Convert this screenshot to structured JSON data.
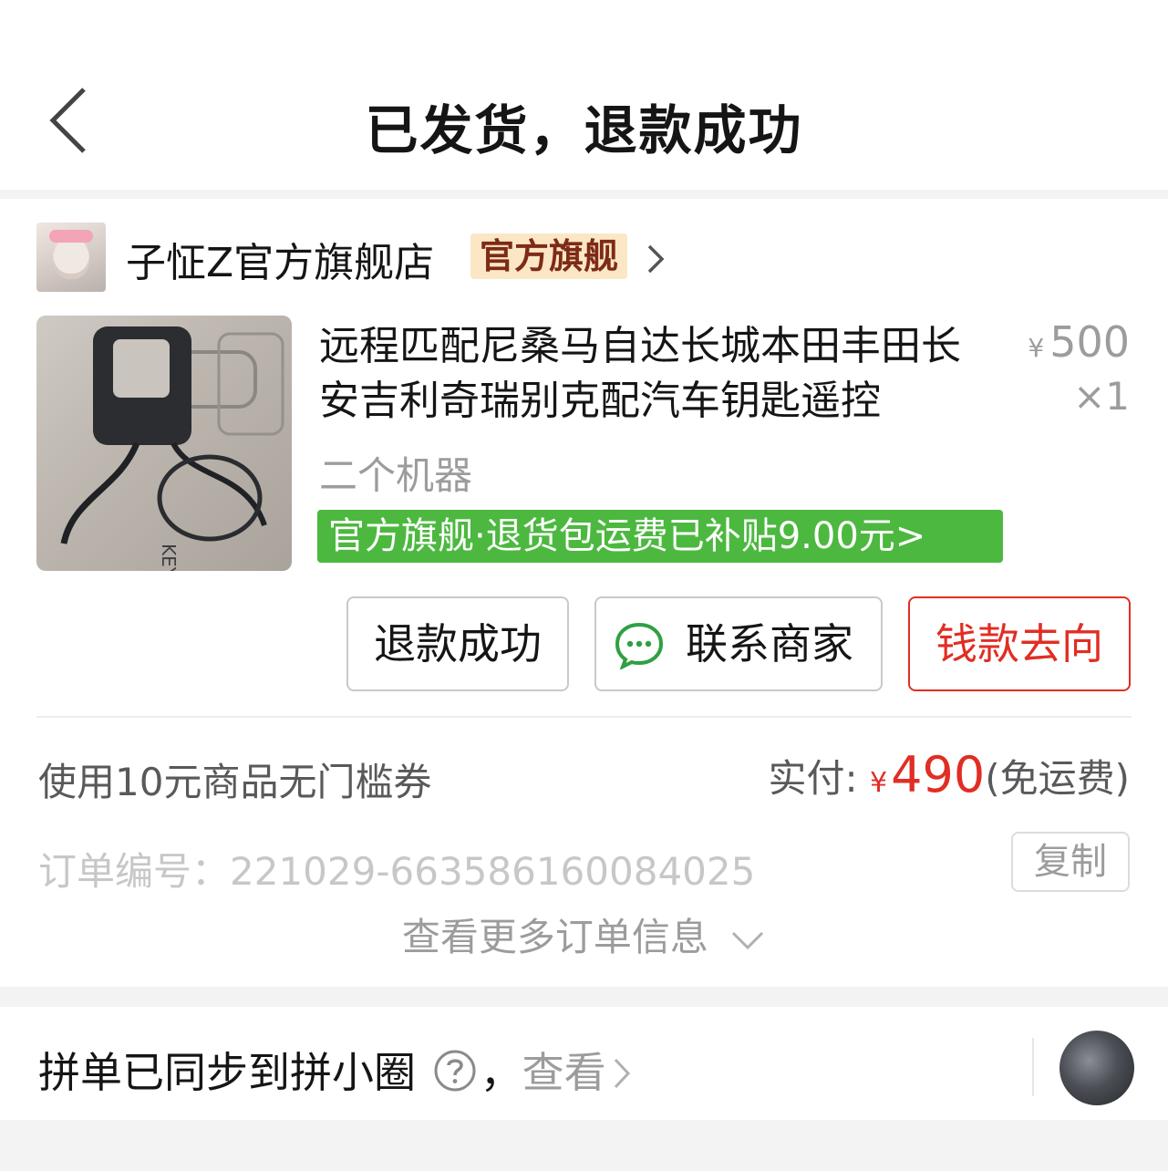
{
  "header": {
    "title": "已发货，退款成功"
  },
  "shop": {
    "name": "子怔Z官方旗舰店",
    "badge": "官方旗舰"
  },
  "product": {
    "name": "远程匹配尼桑马自达长城本田丰田长安吉利奇瑞别克配汽车钥匙遥控",
    "price_symbol": "¥",
    "price": "500",
    "quantity": "×1",
    "spec": "二个机器",
    "shipping_tag": "官方旗舰·退货包运费已补贴9.00元",
    "shipping_tag_arrow": ">"
  },
  "actions": {
    "refund_label": "退款成功",
    "contact_label": "联系商家",
    "money_label": "钱款去向"
  },
  "summary": {
    "coupon": "使用10元商品无门槛券",
    "paid_label": "实付:",
    "paid_symbol": "¥",
    "paid_amount": "490",
    "shipping_note": "(免运费)"
  },
  "order": {
    "number_label": "订单编号：",
    "number": "221029-663586160084025",
    "copy_label": "复制",
    "more_info": "查看更多订单信息"
  },
  "sync": {
    "text": "拼单已同步到拼小圈",
    "separator": "，",
    "view_label": "查看"
  },
  "colors": {
    "accent_red": "#e02e24",
    "tag_green": "#4cb83f",
    "badge_bg": "#fbe6c6",
    "badge_text": "#7d2b16"
  },
  "icons": {
    "back": "chevron-left-icon",
    "shop_arrow": "chevron-right-icon",
    "chat": "chat-bubble-icon",
    "more": "chevron-down-icon",
    "help": "question-circle-icon"
  }
}
